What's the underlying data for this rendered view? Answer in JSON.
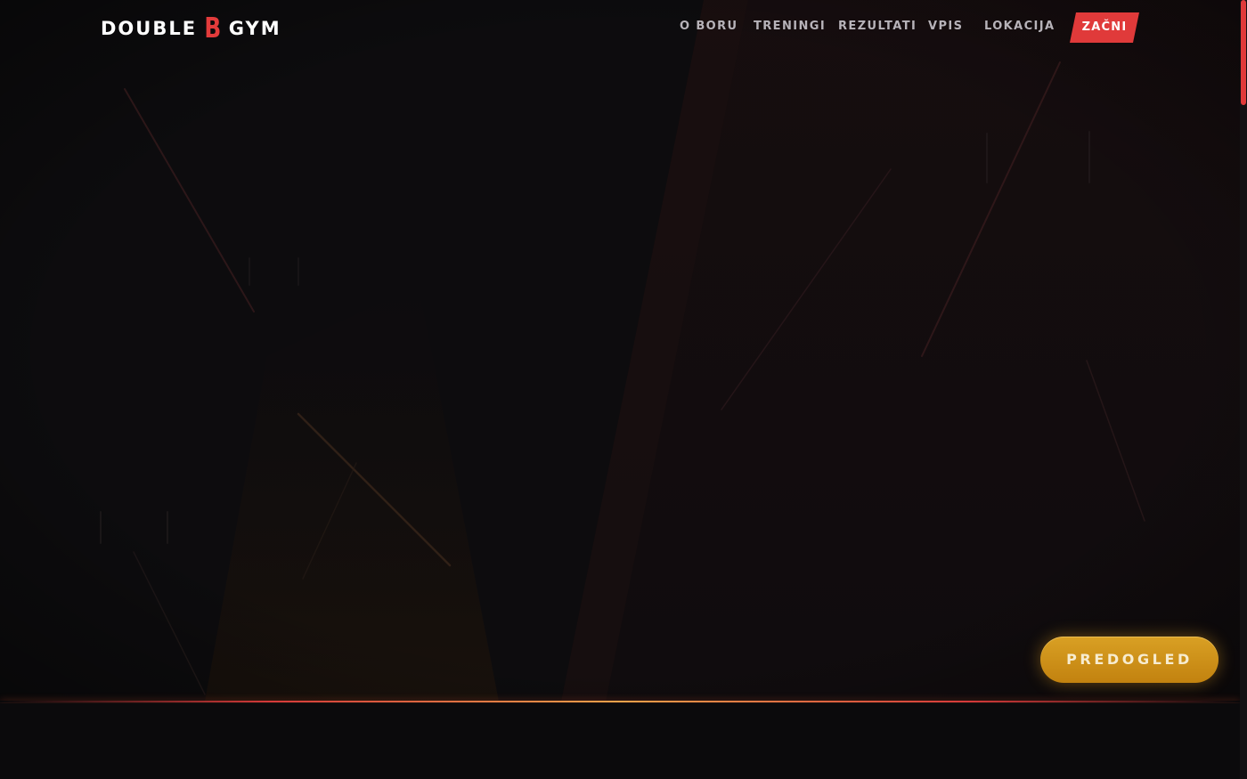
{
  "brand": {
    "word1": "DOUBLE",
    "letter": "B",
    "word2": "GYM",
    "accent_color": "#e23b3b"
  },
  "nav": {
    "items": [
      {
        "label": "O BORU"
      },
      {
        "label": "TRENINGI"
      },
      {
        "label": "REZULTATI"
      },
      {
        "label": "VPIS"
      },
      {
        "label": "LOKACIJA"
      }
    ],
    "cta_label": "ZAČNI",
    "cta_color": "#e03a3a"
  },
  "hero": {
    "preview_label": "PREDOGLED",
    "preview_color": "#d39a1f"
  },
  "scrollbar": {
    "thumb_color": "#e03a3a"
  }
}
